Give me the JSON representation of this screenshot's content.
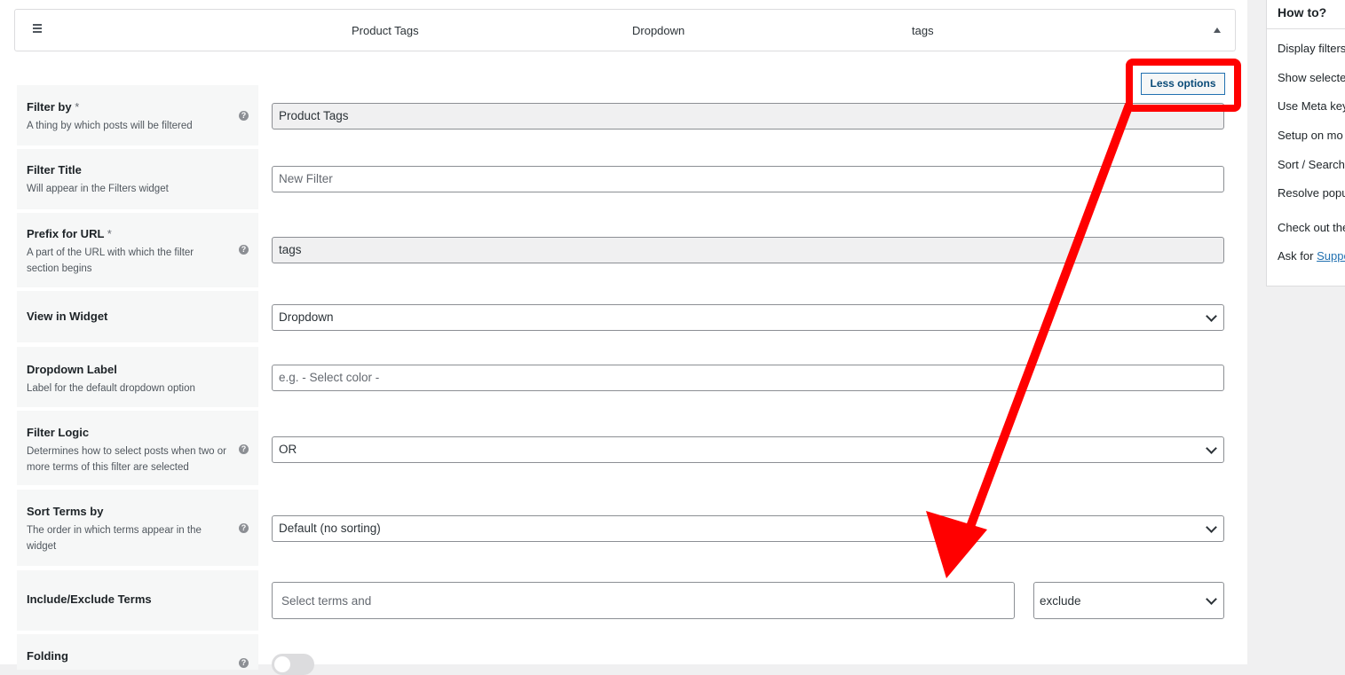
{
  "filter_header": {
    "source": "Product Tags",
    "view": "Dropdown",
    "prefix": "tags"
  },
  "less_options_label": "Less options",
  "help_glyph": "?",
  "fields": {
    "filter_by": {
      "label": "Filter by",
      "required": "*",
      "desc": "A thing by which posts will be filtered",
      "value": "Product Tags"
    },
    "filter_title": {
      "label": "Filter Title",
      "desc": "Will appear in the Filters widget",
      "placeholder": "New Filter"
    },
    "prefix_url": {
      "label": "Prefix for URL",
      "required": "*",
      "desc": "A part of the URL with which the filter section begins",
      "value": "tags"
    },
    "view_widget": {
      "label": "View in Widget",
      "value": "Dropdown"
    },
    "dropdown_label": {
      "label": "Dropdown Label",
      "desc": "Label for the default dropdown option",
      "placeholder": "e.g. - Select color -"
    },
    "filter_logic": {
      "label": "Filter Logic",
      "desc": "Determines how to select posts when two or more terms of this filter are selected",
      "value": "OR"
    },
    "sort_terms": {
      "label": "Sort Terms by",
      "desc": "The order in which terms appear in the widget",
      "value": "Default (no sorting)"
    },
    "include_exclude": {
      "label": "Include/Exclude Terms",
      "placeholder": "Select terms and",
      "mode": "exclude"
    },
    "folding": {
      "label": "Folding"
    }
  },
  "sidebar": {
    "title": "How to?",
    "items": [
      "Display filters",
      "Show selecte",
      "Use Meta key",
      "Setup on mo",
      "Sort / Search",
      "Resolve popu",
      "Check out the"
    ],
    "ask_prefix": "Ask for",
    "ask_link": "Suppo"
  },
  "colors": {
    "annotation": "#ff0000",
    "link": "#2271b1",
    "label_bg": "#f6f7f7"
  }
}
